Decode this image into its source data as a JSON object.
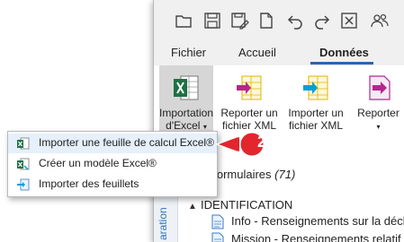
{
  "menu": {
    "items": [
      "Fichier",
      "Accueil",
      "Données"
    ],
    "active": "Données"
  },
  "quick_access": {
    "icons": [
      "open-folder-icon",
      "save-icon",
      "save-as-icon",
      "new-file-icon",
      "undo-icon",
      "redo-icon",
      "excel-icon",
      "users-icon"
    ]
  },
  "ribbon": {
    "import_excel": {
      "line1": "Importation",
      "line2": "d'Excel",
      "caret": "▾"
    },
    "export_xml": {
      "line1": "Reporter un",
      "line2": "fichier XML"
    },
    "import_xml": {
      "line1": "Importer un",
      "line2": "fichier XML"
    },
    "export_more": {
      "line1": "Reporter",
      "caret": "▾"
    },
    "group_fragment": "r"
  },
  "dropdown": {
    "items": [
      {
        "label": "Importer une feuille de calcul Excel®",
        "icon": "excel-sheet-icon"
      },
      {
        "label": "Créer un modèle Excel®",
        "icon": "excel-template-icon"
      },
      {
        "label": "Importer des feuillets",
        "icon": "import-sheets-icon"
      }
    ]
  },
  "callout": {
    "number": "2"
  },
  "content": {
    "vertical_tab": "aration",
    "forms_heading": "les formulaires",
    "forms_count": "(71)",
    "section_toggle": "▲",
    "section_title": "IDENTIFICATION",
    "items": [
      "Info - Renseignements sur la décl",
      "Mission - Renseignements relatif"
    ]
  },
  "colors": {
    "accent_blue": "#2b63b6",
    "callout_red": "#e3262d",
    "excel_green": "#1e7145",
    "xml_magenta": "#b2278e",
    "xml_cyan": "#00a0dc"
  }
}
